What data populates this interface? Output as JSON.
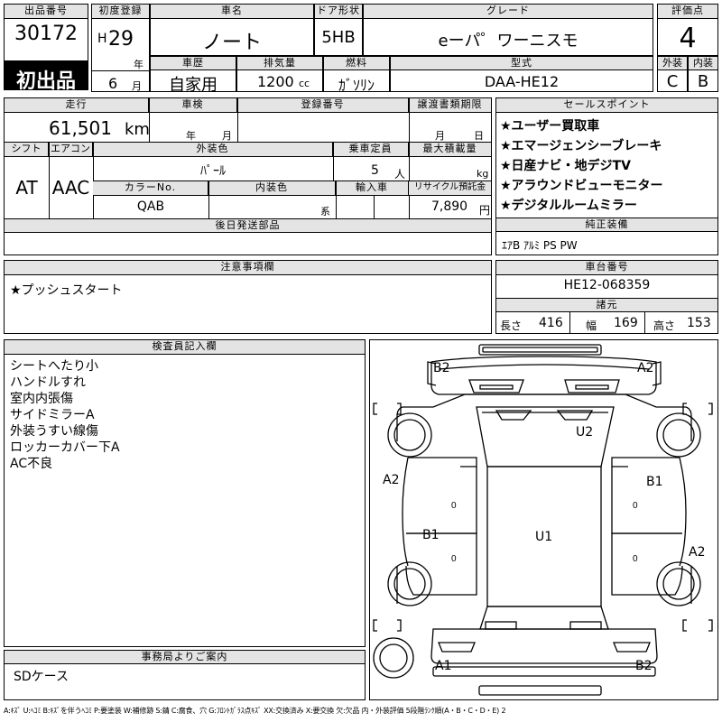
{
  "header": {
    "lot_label": "出品番号",
    "lot_number": "30172",
    "first_listing": "初出品",
    "reg_label": "初度登録",
    "era": "H",
    "reg_year": "29",
    "year_unit": "年",
    "reg_month": "6",
    "month_unit": "月",
    "car_name_label": "車名",
    "car_name": "ノート",
    "door_label": "ドア形状",
    "door": "5HB",
    "grade_label": "グレード",
    "grade": "eーパ゜ワーニスモ",
    "score_label": "評価点",
    "score": "4",
    "history_label": "車歴",
    "history": "自家用",
    "displacement_label": "排気量",
    "displacement": "1200",
    "displacement_unit": "cc",
    "fuel_label": "燃料",
    "fuel": "ｶﾞｿﾘﾝ",
    "model_label": "型式",
    "model": "DAA-HE12",
    "exterior_label": "外装",
    "exterior_grade": "C",
    "interior_label": "内装",
    "interior_grade": "B"
  },
  "specs": {
    "mileage_label": "走行",
    "mileage": "61,501",
    "mileage_unit": "km",
    "inspection_label": "車検",
    "inspection_year_unit": "年",
    "inspection_month_unit": "月",
    "regno_label": "登録番号",
    "transfer_label": "譲渡書類期限",
    "transfer_month_unit": "月",
    "transfer_day_unit": "日",
    "shift_label": "シフト",
    "shift": "AT",
    "ac_label": "エアコン",
    "ac": "AAC",
    "color_label": "外装色",
    "color": "ﾊﾟｰﾙ",
    "capacity_label": "乗車定員",
    "capacity": "5",
    "capacity_unit": "人",
    "load_label": "最大積載量",
    "load_unit": "kg",
    "color_no_label": "カラーNo.",
    "color_no": "QAB",
    "interior_color_label": "内装色",
    "interior_color_unit": "系",
    "import_label": "輸入車",
    "recycle_label": "リサイクル預託金",
    "recycle": "7,890",
    "recycle_unit": "円",
    "later_parts_label": "後日発送部品"
  },
  "sales_points": {
    "label": "セールスポイント",
    "items": [
      "★ユーザー買取車",
      "★エマージェンシーブレーキ",
      "★日産ナビ・地デジTV",
      "★アラウンドビューモニター",
      "★デジタルルームミラー"
    ]
  },
  "equipment": {
    "label": "純正装備",
    "value": "ｴｱB ｱﾙﾐ PS PW"
  },
  "notes": {
    "label": "注意事項欄",
    "value": "★プッシュスタート"
  },
  "chassis": {
    "label": "車台番号",
    "value": "HE12-068359",
    "dims_label": "諸元",
    "length_label": "長さ",
    "length": "416",
    "width_label": "幅",
    "width": "169",
    "height_label": "高さ",
    "height": "153"
  },
  "inspector": {
    "label": "検査員記入欄",
    "lines": [
      "シートへたり小",
      "ハンドルすれ",
      "室内内張傷",
      "サイドミラーA",
      "外装うすい線傷",
      "ロッカーカバー下A",
      "AC不良"
    ]
  },
  "office": {
    "label": "事務局よりご案内",
    "value": "SDケース"
  },
  "diagram": {
    "marks": {
      "b2_tl": "B2",
      "a2_tr": "A2",
      "u2": "U2",
      "a2_l": "A2",
      "b1_r": "B1",
      "b1_l": "B1",
      "u1": "U1",
      "a2_r": "A2",
      "a1_bl": "A1",
      "b2_br": "B2"
    }
  },
  "legend": "A:ｷｽﾞ U:ﾍｺﾐ B:ｷｽﾞを伴うﾍｺﾐ P:要塗装 W:補修跡 S:錆 C:腐食、穴 G:ﾌﾛﾝﾄｶﾞﾗｽ点ｷｽﾞ XX:交換済み X:要交換 欠:欠品 内・外装評価 5段階ﾗﾝｸ順(A・B・C・D・E) 2"
}
